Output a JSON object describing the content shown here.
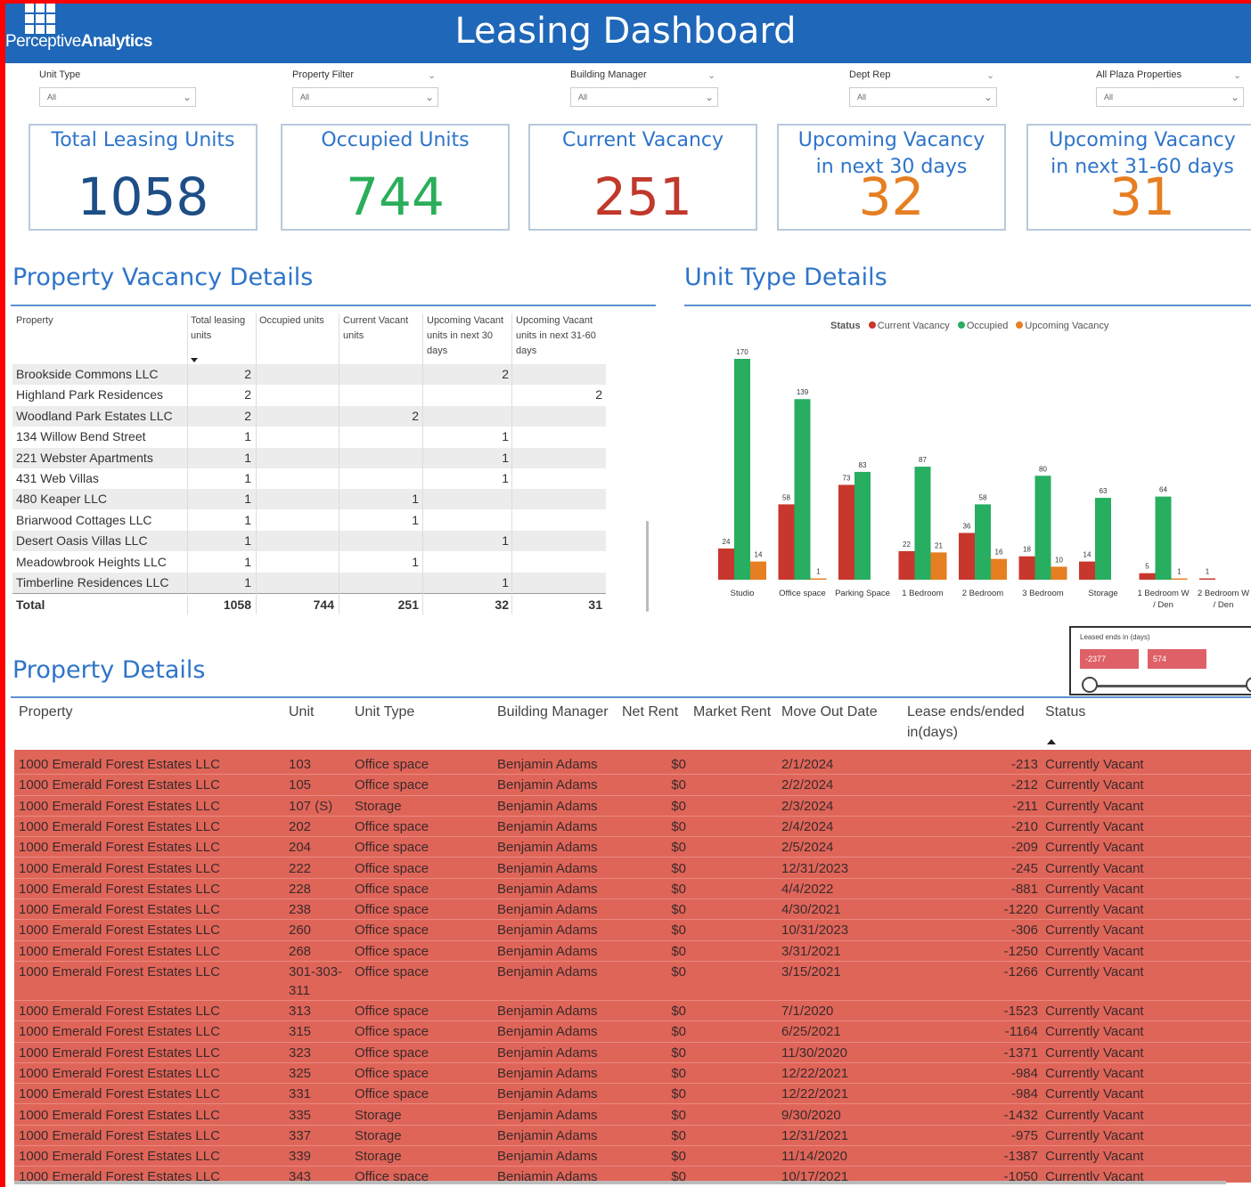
{
  "header": {
    "title": "Leasing Dashboard",
    "logo_light": "Perceptive",
    "logo_bold": "Analytics"
  },
  "filters": [
    {
      "label": "Unit Type",
      "value": "All"
    },
    {
      "label": "Property Filter",
      "value": "All"
    },
    {
      "label": "Building Manager",
      "value": "All"
    },
    {
      "label": "Dept Rep",
      "value": "All"
    },
    {
      "label": "All Plaza Properties",
      "value": "All"
    }
  ],
  "cards": [
    {
      "label": "Total Leasing Units",
      "value": "1058",
      "color": "#1e4e86"
    },
    {
      "label": "Occupied Units",
      "value": "744",
      "color": "#2bae5a"
    },
    {
      "label": "Current Vacancy",
      "value": "251",
      "color": "#c0392b"
    },
    {
      "label": "Upcoming Vacancy in next 30 days",
      "value": "32",
      "color": "#e67e22"
    },
    {
      "label": "Upcoming Vacancy in next 31-60 days",
      "value": "31",
      "color": "#e67e22"
    }
  ],
  "vacancy": {
    "title": "Property Vacancy Details",
    "headers": [
      "Property",
      "Total leasing units",
      "Occupied units",
      "Current Vacant units",
      "Upcoming Vacant units in next 30 days",
      "Upcoming Vacant units in next 31-60 days"
    ],
    "rows": [
      [
        "Brookside Commons LLC",
        "2",
        "",
        "",
        "2",
        ""
      ],
      [
        "Highland Park Residences",
        "2",
        "",
        "",
        "",
        "2"
      ],
      [
        "Woodland Park Estates LLC",
        "2",
        "",
        "2",
        "",
        ""
      ],
      [
        "134 Willow Bend Street",
        "1",
        "",
        "",
        "1",
        ""
      ],
      [
        "221 Webster Apartments",
        "1",
        "",
        "",
        "1",
        ""
      ],
      [
        "431 Web Villas",
        "1",
        "",
        "",
        "1",
        ""
      ],
      [
        "480 Keaper LLC",
        "1",
        "",
        "1",
        "",
        ""
      ],
      [
        "Briarwood Cottages LLC",
        "1",
        "",
        "1",
        "",
        ""
      ],
      [
        "Desert Oasis Villas LLC",
        "1",
        "",
        "",
        "1",
        ""
      ],
      [
        "Meadowbrook Heights LLC",
        "1",
        "",
        "1",
        "",
        ""
      ],
      [
        "Timberline Residences LLC",
        "1",
        "",
        "",
        "1",
        ""
      ]
    ],
    "total": [
      "Total",
      "1058",
      "744",
      "251",
      "32",
      "31"
    ]
  },
  "unit_type": {
    "title": "Unit Type Details",
    "legend_title": "Status",
    "colors": {
      "Current Vacancy": "#c8372d",
      "Occupied": "#27ae60",
      "Upcoming Vacancy": "#e67e22"
    }
  },
  "chart_data": {
    "type": "bar",
    "categories": [
      "Studio",
      "Office space",
      "Parking Space",
      "1 Bedroom",
      "2 Bedroom",
      "3 Bedroom",
      "Storage",
      "1 Bedroom W / Den",
      "2 Bedroom W / Den"
    ],
    "series": [
      {
        "name": "Current Vacancy",
        "values": [
          24,
          58,
          73,
          22,
          36,
          18,
          14,
          5,
          1
        ]
      },
      {
        "name": "Occupied",
        "values": [
          170,
          139,
          83,
          87,
          58,
          80,
          63,
          64,
          null
        ]
      },
      {
        "name": "Upcoming Vacancy",
        "values": [
          14,
          1,
          null,
          21,
          16,
          10,
          null,
          1,
          null
        ]
      }
    ],
    "legend": "top",
    "grid": false
  },
  "slicer": {
    "label": "Leased ends in (days)",
    "min": "-2377",
    "max": "574"
  },
  "details": {
    "title": "Property Details",
    "headers": [
      "Property",
      "Unit",
      "Unit Type",
      "Building Manager",
      "Net Rent",
      "Market Rent",
      "Move Out Date",
      "Lease ends/ended in(days)",
      "Status"
    ],
    "rows": [
      [
        "1000 Emerald Forest Estates LLC",
        "103",
        "Office space",
        "Benjamin Adams",
        "$0",
        "",
        "2/1/2024",
        "-213",
        "Currently Vacant"
      ],
      [
        "1000 Emerald Forest Estates LLC",
        "105",
        "Office space",
        "Benjamin Adams",
        "$0",
        "",
        "2/2/2024",
        "-212",
        "Currently Vacant"
      ],
      [
        "1000 Emerald Forest Estates LLC",
        "107 (S)",
        "Storage",
        "Benjamin Adams",
        "$0",
        "",
        "2/3/2024",
        "-211",
        "Currently Vacant"
      ],
      [
        "1000 Emerald Forest Estates LLC",
        "202",
        "Office space",
        "Benjamin Adams",
        "$0",
        "",
        "2/4/2024",
        "-210",
        "Currently Vacant"
      ],
      [
        "1000 Emerald Forest Estates LLC",
        "204",
        "Office space",
        "Benjamin Adams",
        "$0",
        "",
        "2/5/2024",
        "-209",
        "Currently Vacant"
      ],
      [
        "1000 Emerald Forest Estates LLC",
        "222",
        "Office space",
        "Benjamin Adams",
        "$0",
        "",
        "12/31/2023",
        "-245",
        "Currently Vacant"
      ],
      [
        "1000 Emerald Forest Estates LLC",
        "228",
        "Office space",
        "Benjamin Adams",
        "$0",
        "",
        "4/4/2022",
        "-881",
        "Currently Vacant"
      ],
      [
        "1000 Emerald Forest Estates LLC",
        "238",
        "Office space",
        "Benjamin Adams",
        "$0",
        "",
        "4/30/2021",
        "-1220",
        "Currently Vacant"
      ],
      [
        "1000 Emerald Forest Estates LLC",
        "260",
        "Office space",
        "Benjamin Adams",
        "$0",
        "",
        "10/31/2023",
        "-306",
        "Currently Vacant"
      ],
      [
        "1000 Emerald Forest Estates LLC",
        "268",
        "Office space",
        "Benjamin Adams",
        "$0",
        "",
        "3/31/2021",
        "-1250",
        "Currently Vacant"
      ],
      [
        "1000 Emerald Forest Estates LLC",
        "301-303-311",
        "Office space",
        "Benjamin Adams",
        "$0",
        "",
        "3/15/2021",
        "-1266",
        "Currently Vacant"
      ],
      [
        "1000 Emerald Forest Estates LLC",
        "313",
        "Office space",
        "Benjamin Adams",
        "$0",
        "",
        "7/1/2020",
        "-1523",
        "Currently Vacant"
      ],
      [
        "1000 Emerald Forest Estates LLC",
        "315",
        "Office space",
        "Benjamin Adams",
        "$0",
        "",
        "6/25/2021",
        "-1164",
        "Currently Vacant"
      ],
      [
        "1000 Emerald Forest Estates LLC",
        "323",
        "Office space",
        "Benjamin Adams",
        "$0",
        "",
        "11/30/2020",
        "-1371",
        "Currently Vacant"
      ],
      [
        "1000 Emerald Forest Estates LLC",
        "325",
        "Office space",
        "Benjamin Adams",
        "$0",
        "",
        "12/22/2021",
        "-984",
        "Currently Vacant"
      ],
      [
        "1000 Emerald Forest Estates LLC",
        "331",
        "Office space",
        "Benjamin Adams",
        "$0",
        "",
        "12/22/2021",
        "-984",
        "Currently Vacant"
      ],
      [
        "1000 Emerald Forest Estates LLC",
        "335",
        "Storage",
        "Benjamin Adams",
        "$0",
        "",
        "9/30/2020",
        "-1432",
        "Currently Vacant"
      ],
      [
        "1000 Emerald Forest Estates LLC",
        "337",
        "Storage",
        "Benjamin Adams",
        "$0",
        "",
        "12/31/2021",
        "-975",
        "Currently Vacant"
      ],
      [
        "1000 Emerald Forest Estates LLC",
        "339",
        "Storage",
        "Benjamin Adams",
        "$0",
        "",
        "11/14/2020",
        "-1387",
        "Currently Vacant"
      ],
      [
        "1000 Emerald Forest Estates LLC",
        "343",
        "Office space",
        "Benjamin Adams",
        "$0",
        "",
        "10/17/2021",
        "-1050",
        "Currently Vacant"
      ]
    ]
  }
}
